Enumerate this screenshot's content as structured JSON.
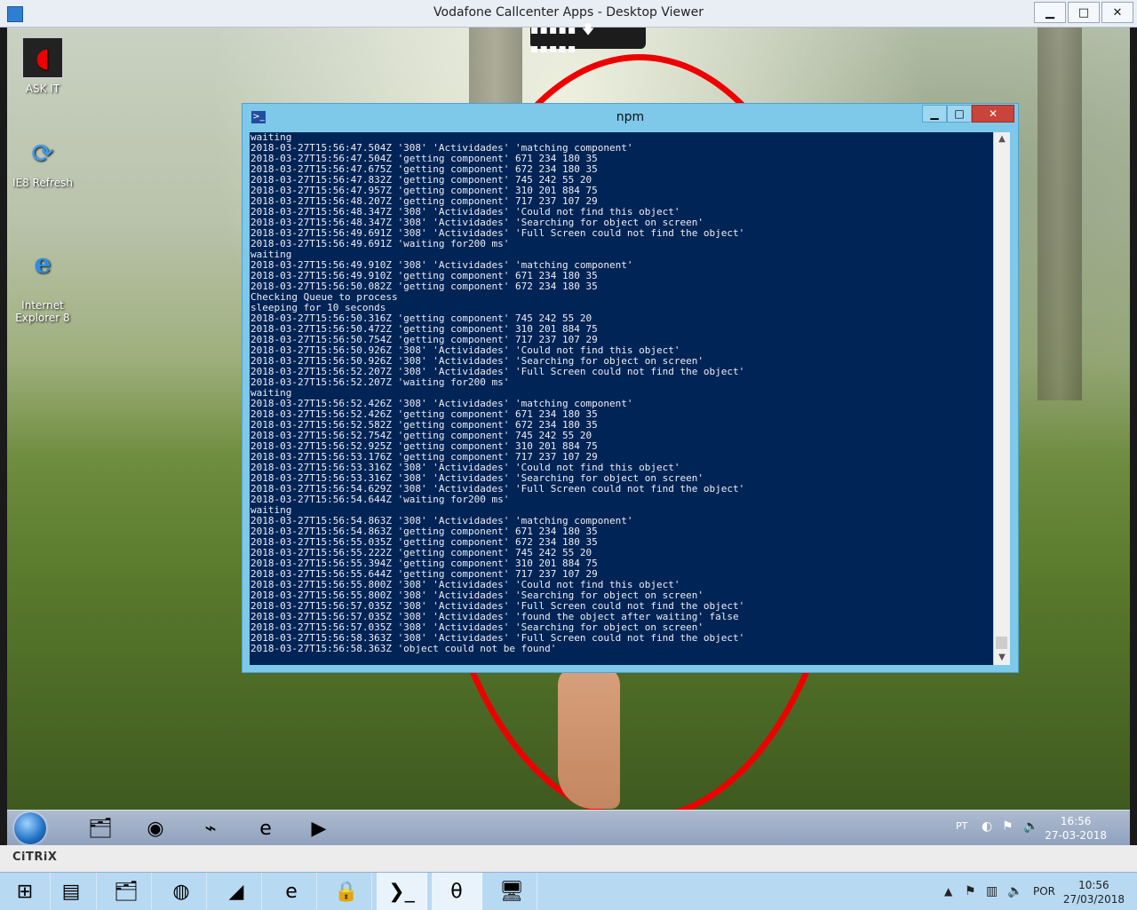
{
  "viewer": {
    "title": "Vodafone Callcenter Apps - Desktop Viewer",
    "controls": {
      "minimize": "▁",
      "maximize": "□",
      "close": "✕"
    }
  },
  "desktop_icons": [
    {
      "label": "ASK IT",
      "icon": "vodafone-laptop-icon"
    },
    {
      "label": "IE8 Refresh",
      "icon": "refresh-arrows-icon"
    },
    {
      "label": "Internet\nExplorer 8",
      "icon": "internet-explorer-icon"
    }
  ],
  "citrix_bar": {
    "glyph": "▪▪▪▪▪ 🡇 ▪▪▪▪▪"
  },
  "npm_window": {
    "title": "npm",
    "controls": {
      "minimize": "▁",
      "maximize": "□",
      "close": "✕"
    },
    "console_lines": [
      "waiting",
      "2018-03-27T15:56:47.504Z '308' 'Actividades' 'matching component'",
      "2018-03-27T15:56:47.504Z 'getting component' 671 234 180 35",
      "2018-03-27T15:56:47.675Z 'getting component' 672 234 180 35",
      "2018-03-27T15:56:47.832Z 'getting component' 745 242 55 20",
      "2018-03-27T15:56:47.957Z 'getting component' 310 201 884 75",
      "2018-03-27T15:56:48.207Z 'getting component' 717 237 107 29",
      "2018-03-27T15:56:48.347Z '308' 'Actividades' 'Could not find this object'",
      "2018-03-27T15:56:48.347Z '308' 'Actividades' 'Searching for object on screen'",
      "2018-03-27T15:56:49.691Z '308' 'Actividades' 'Full Screen could not find the object'",
      "2018-03-27T15:56:49.691Z 'waiting for200 ms'",
      "waiting",
      "2018-03-27T15:56:49.910Z '308' 'Actividades' 'matching component'",
      "2018-03-27T15:56:49.910Z 'getting component' 671 234 180 35",
      "2018-03-27T15:56:50.082Z 'getting component' 672 234 180 35",
      "Checking Queue to process",
      "sleeping for 10 seconds",
      "2018-03-27T15:56:50.316Z 'getting component' 745 242 55 20",
      "2018-03-27T15:56:50.472Z 'getting component' 310 201 884 75",
      "2018-03-27T15:56:50.754Z 'getting component' 717 237 107 29",
      "2018-03-27T15:56:50.926Z '308' 'Actividades' 'Could not find this object'",
      "2018-03-27T15:56:50.926Z '308' 'Actividades' 'Searching for object on screen'",
      "2018-03-27T15:56:52.207Z '308' 'Actividades' 'Full Screen could not find the object'",
      "2018-03-27T15:56:52.207Z 'waiting for200 ms'",
      "waiting",
      "2018-03-27T15:56:52.426Z '308' 'Actividades' 'matching component'",
      "2018-03-27T15:56:52.426Z 'getting component' 671 234 180 35",
      "2018-03-27T15:56:52.582Z 'getting component' 672 234 180 35",
      "2018-03-27T15:56:52.754Z 'getting component' 745 242 55 20",
      "2018-03-27T15:56:52.925Z 'getting component' 310 201 884 75",
      "2018-03-27T15:56:53.176Z 'getting component' 717 237 107 29",
      "2018-03-27T15:56:53.316Z '308' 'Actividades' 'Could not find this object'",
      "2018-03-27T15:56:53.316Z '308' 'Actividades' 'Searching for object on screen'",
      "2018-03-27T15:56:54.629Z '308' 'Actividades' 'Full Screen could not find the object'",
      "2018-03-27T15:56:54.644Z 'waiting for200 ms'",
      "waiting",
      "2018-03-27T15:56:54.863Z '308' 'Actividades' 'matching component'",
      "2018-03-27T15:56:54.863Z 'getting component' 671 234 180 35",
      "2018-03-27T15:56:55.035Z 'getting component' 672 234 180 35",
      "2018-03-27T15:56:55.222Z 'getting component' 745 242 55 20",
      "2018-03-27T15:56:55.394Z 'getting component' 310 201 884 75",
      "2018-03-27T15:56:55.644Z 'getting component' 717 237 107 29",
      "2018-03-27T15:56:55.800Z '308' 'Actividades' 'Could not find this object'",
      "2018-03-27T15:56:55.800Z '308' 'Actividades' 'Searching for object on screen'",
      "2018-03-27T15:56:57.035Z '308' 'Actividades' 'Full Screen could not find the object'",
      "2018-03-27T15:56:57.035Z '308' 'Actividades' 'found the object after waiting' false",
      "2018-03-27T15:56:57.035Z '308' 'Actividades' 'Searching for object on screen'",
      "2018-03-27T15:56:58.363Z '308' 'Actividades' 'Full Screen could not find the object'",
      "2018-03-27T15:56:58.363Z 'object could not be found'"
    ]
  },
  "remote_taskbar": {
    "apps": [
      {
        "name": "file-explorer-icon",
        "glyph": "🗂"
      },
      {
        "name": "chrome-icon",
        "glyph": "◉"
      },
      {
        "name": "monitor-pulse-icon",
        "glyph": "⌁"
      },
      {
        "name": "internet-explorer-icon",
        "glyph": "e"
      },
      {
        "name": "media-player-icon",
        "glyph": "▶"
      }
    ],
    "lang": "PT",
    "time": "16:56",
    "date": "27-03-2018"
  },
  "citrix_strip": {
    "logo": "CiTRiX"
  },
  "local_taskbar": {
    "apps": [
      {
        "name": "windows-start-icon",
        "glyph": "⊞"
      },
      {
        "name": "server-manager-icon",
        "glyph": "▤"
      },
      {
        "name": "file-explorer-icon",
        "glyph": "🗂"
      },
      {
        "name": "firefox-icon",
        "glyph": "◍"
      },
      {
        "name": "azure-icon",
        "glyph": "◢"
      },
      {
        "name": "internet-explorer-icon",
        "glyph": "e"
      },
      {
        "name": "lock-app-icon",
        "glyph": "🔒"
      },
      {
        "name": "powershell-icon",
        "glyph": "❯_"
      },
      {
        "name": "theta-app-icon",
        "glyph": "θ"
      },
      {
        "name": "desktop-viewer-icon",
        "glyph": "🖥"
      }
    ],
    "lang": "POR",
    "time": "10:56",
    "date": "27/03/2018"
  }
}
